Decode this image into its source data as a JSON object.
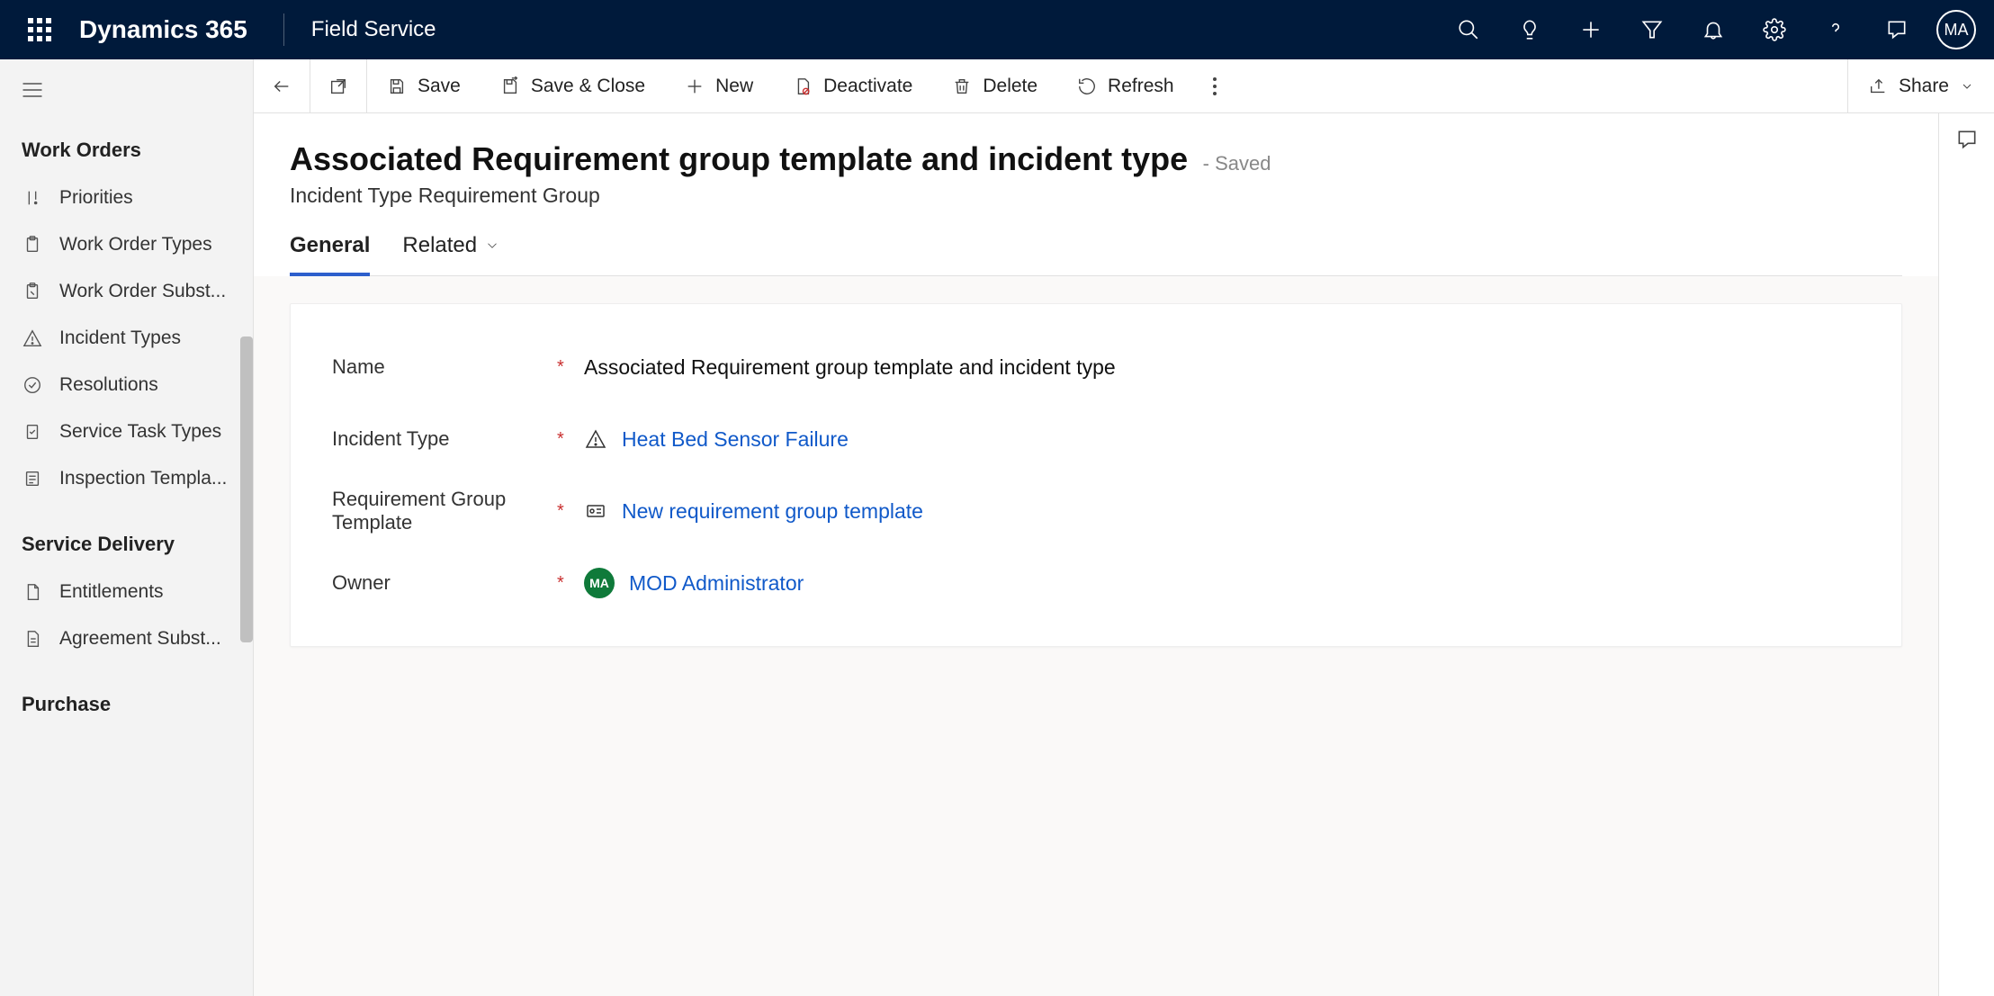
{
  "topbar": {
    "brand": "Dynamics 365",
    "app": "Field Service",
    "avatar": "MA"
  },
  "sidebar": {
    "sections": [
      {
        "title": "Work Orders",
        "items": [
          {
            "label": "Priorities"
          },
          {
            "label": "Work Order Types"
          },
          {
            "label": "Work Order Subst..."
          },
          {
            "label": "Incident Types"
          },
          {
            "label": "Resolutions"
          },
          {
            "label": "Service Task Types"
          },
          {
            "label": "Inspection Templa..."
          }
        ]
      },
      {
        "title": "Service Delivery",
        "items": [
          {
            "label": "Entitlements"
          },
          {
            "label": "Agreement Subst..."
          }
        ]
      },
      {
        "title": "Purchase",
        "items": []
      }
    ]
  },
  "commands": {
    "save": "Save",
    "save_close": "Save & Close",
    "new": "New",
    "deactivate": "Deactivate",
    "delete": "Delete",
    "refresh": "Refresh",
    "share": "Share"
  },
  "form": {
    "title": "Associated Requirement group template and incident type",
    "save_state": "- Saved",
    "entity": "Incident Type Requirement Group",
    "tabs": {
      "general": "General",
      "related": "Related"
    },
    "fields": {
      "name": {
        "label": "Name",
        "value": "Associated Requirement group template and incident type"
      },
      "incident_type": {
        "label": "Incident Type",
        "value": "Heat Bed Sensor Failure"
      },
      "req_group": {
        "label": "Requirement Group Template",
        "value": "New requirement group template"
      },
      "owner": {
        "label": "Owner",
        "value": "MOD Administrator",
        "initials": "MA"
      }
    }
  }
}
